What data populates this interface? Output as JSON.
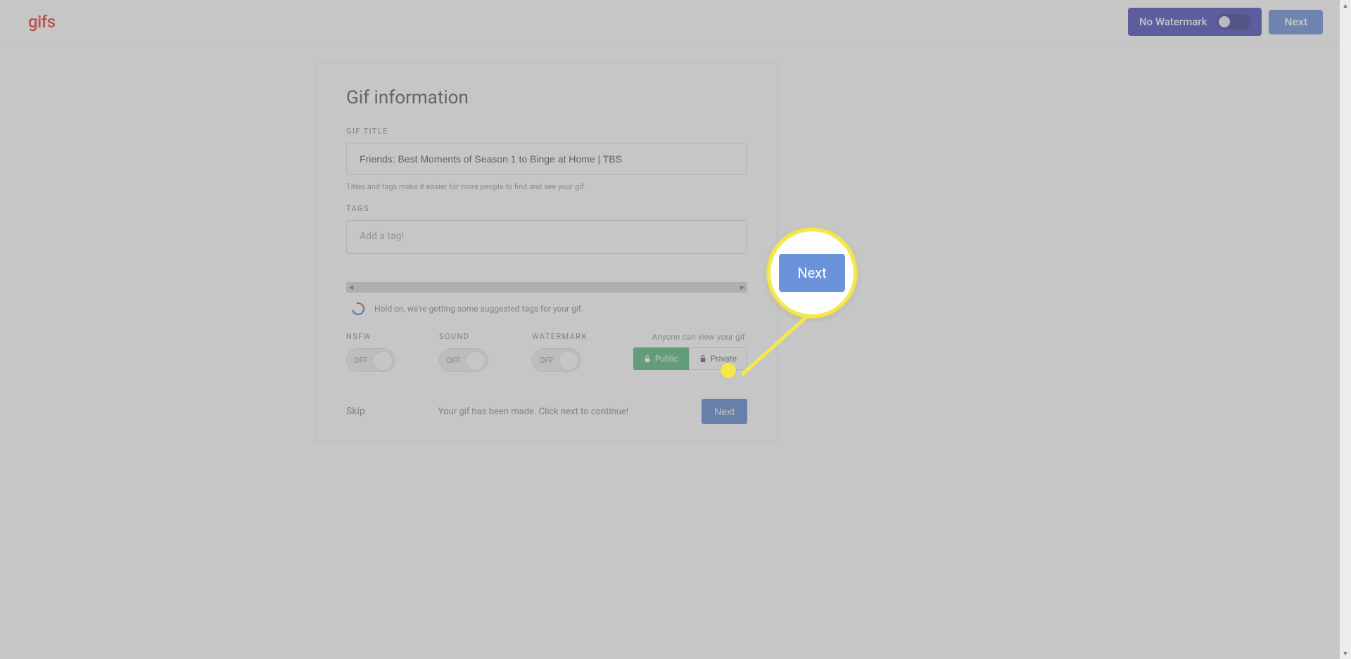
{
  "header": {
    "logo": "gifs",
    "watermark_label": "No Watermark",
    "next_label": "Next"
  },
  "form": {
    "heading": "Gif information",
    "title_label": "GIF TITLE",
    "title_value": "Friends: Best Moments of Season 1 to Binge at Home | TBS",
    "title_hint": "Titles and tags make it easier for more people to find and see your gif.",
    "tags_label": "TAGS",
    "tags_placeholder": "Add a tag!",
    "suggest_msg": "Hold on, we're getting some suggested tags for your gif.",
    "toggles": {
      "nsfw_label": "NSFW",
      "nsfw_value": "OFF",
      "sound_label": "SOUND",
      "sound_value": "OFF",
      "watermark_label": "WATERMARK",
      "watermark_value": "OFF"
    },
    "visibility": {
      "hint": "Anyone can view your gif.",
      "public_label": "Public",
      "private_label": "Private"
    },
    "skip_label": "Skip",
    "made_msg": "Your gif has been made. Click next to continue!",
    "next_label": "Next"
  },
  "callout": {
    "button_label": "Next"
  }
}
